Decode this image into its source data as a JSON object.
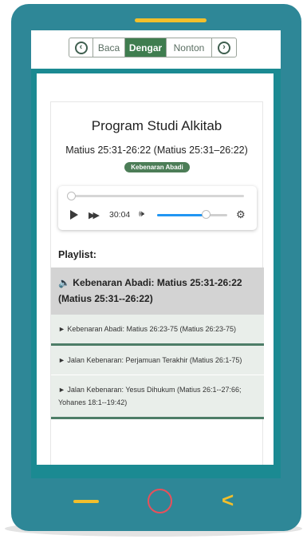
{
  "nav": {
    "prev_icon": "chevron-left-icon",
    "tabs": [
      {
        "label": "Baca",
        "active": false
      },
      {
        "label": "Dengar",
        "active": true
      },
      {
        "label": "Nonton",
        "active": false
      }
    ],
    "next_icon": "chevron-right-icon",
    "active_color": "#3f7d4f"
  },
  "program": {
    "title": "Program Studi Alkitab",
    "reference": "Matius 25:31-26:22 (Matius 25:31–26:22)",
    "badge": "Kebenaran Abadi"
  },
  "player": {
    "progress": 0,
    "time": "30:04",
    "volume": 0.7,
    "icons": [
      "play-icon",
      "fast-forward-icon",
      "volume-icon",
      "gear-icon"
    ]
  },
  "playlist": {
    "label": "Playlist:",
    "items": [
      {
        "text": "Kebenaran Abadi: Matius 25:31-26:22 (Matius 25:31--26:22)",
        "active": true
      },
      {
        "text": "Kebenaran Abadi: Matius 26:23-75 (Matius 26:23-75)",
        "active": false
      },
      {
        "text": "Jalan Kebenaran: Perjamuan Terakhir (Matius 26:1-75)",
        "active": false
      },
      {
        "text": "Jalan Kebenaran: Yesus Dihukum (Matius 26:1--27:66; Yohanes 18:1--19:42)",
        "active": false
      }
    ]
  },
  "device": {
    "frame_color": "#2e8797",
    "accent_yellow": "#f2bf2b",
    "accent_red": "#e8505b",
    "back_symbol": "<"
  }
}
